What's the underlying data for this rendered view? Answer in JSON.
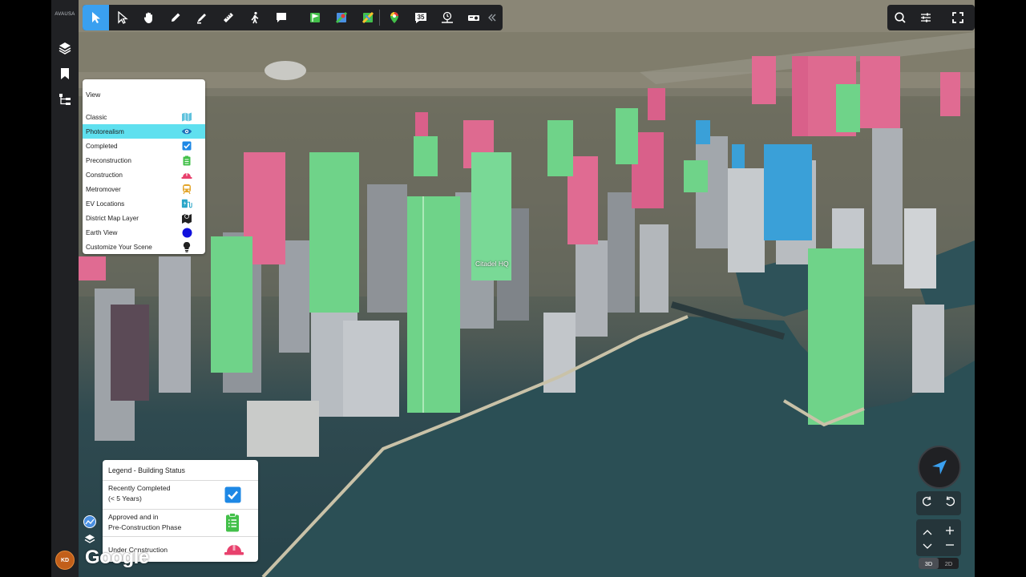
{
  "rail": {
    "logo_text": "AVAUSA",
    "items": [
      "layers-icon",
      "bookmark-icon",
      "hierarchy-icon"
    ],
    "avatar_initials": "KD"
  },
  "toolbar": {
    "tools": [
      "select-arrow-icon",
      "pointer-icon",
      "hand-icon",
      "pencil-icon",
      "marker-icon",
      "ruler-icon",
      "walk-icon",
      "comment-icon",
      "map-flag-icon",
      "map-pin-icon",
      "map-route-icon",
      "location-pin-icon",
      "calendar-35-icon",
      "timer-icon",
      "projector-icon",
      "collapse-icon"
    ],
    "calendar_badge": "35"
  },
  "top_right": [
    "search-icon",
    "sliders-icon",
    "fullscreen-icon"
  ],
  "view_menu": {
    "title": "View",
    "items": [
      {
        "label": "Classic",
        "icon": "map-icon",
        "color": "#5fc2dd"
      },
      {
        "label": "Photorealism",
        "icon": "eye-icon",
        "color": "#1d6fb8",
        "selected": true
      },
      {
        "label": "Completed",
        "icon": "checkbox-icon",
        "color": "#1e88e5"
      },
      {
        "label": "Preconstruction",
        "icon": "clipboard-icon",
        "color": "#43c04a"
      },
      {
        "label": "Construction",
        "icon": "hardhat-icon",
        "color": "#e8416d"
      },
      {
        "label": "Metromover",
        "icon": "tram-icon",
        "color": "#e3a52a"
      },
      {
        "label": "EV Locations",
        "icon": "ev-icon",
        "color": "#2aa6c8"
      },
      {
        "label": "District Map Layer",
        "icon": "district-map-icon",
        "color": "#222222"
      },
      {
        "label": "Earth View",
        "icon": "globe-dot-icon",
        "color": "#1111dd"
      },
      {
        "label": "Customize Your Scene",
        "icon": "lightbulb-icon",
        "color": "#222222"
      }
    ]
  },
  "scene": {
    "label": "Citadel HQ"
  },
  "legend": {
    "title": "Legend - Building Status",
    "rows": [
      {
        "line1": "Recently Completed",
        "line2": "(< 5 Years)",
        "icon": "checkbox-icon",
        "color": "#1e88e5"
      },
      {
        "line1": "Approved and in",
        "line2": "Pre-Construction Phase",
        "icon": "clipboard-icon",
        "color": "#43c04a"
      },
      {
        "line1": "Under Construction",
        "line2": "",
        "icon": "hardhat-icon",
        "color": "#e8416d"
      }
    ]
  },
  "nav": {
    "mode_3d": "3D",
    "mode_2d": "2D",
    "active_mode": "3D"
  },
  "attribution": "Google"
}
